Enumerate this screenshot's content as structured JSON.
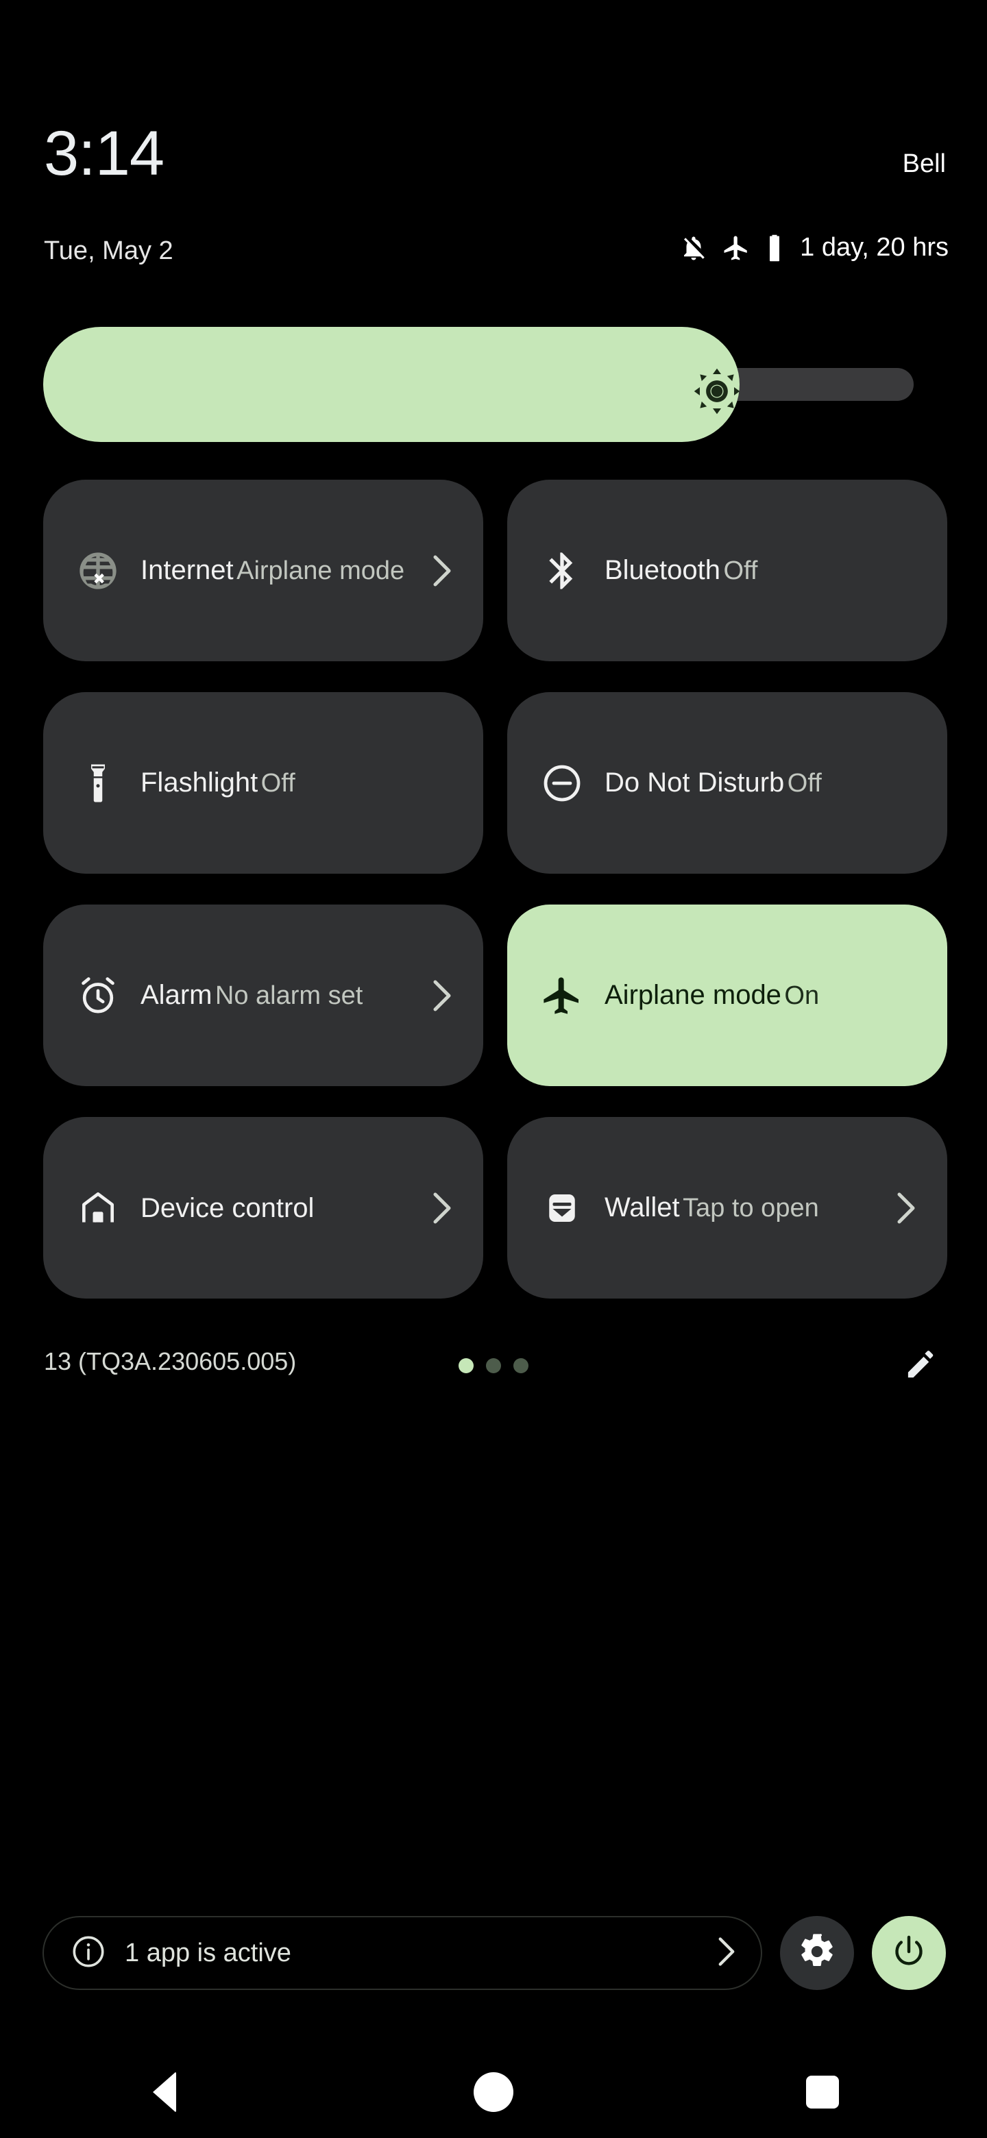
{
  "status": {
    "time": "3:14",
    "carrier": "Bell",
    "date": "Tue, May 2",
    "battery_estimate": "1 day, 20 hrs",
    "icons": [
      "notifications-off-icon",
      "airplane-icon",
      "battery-icon"
    ]
  },
  "brightness": {
    "label": "Brightness",
    "value_percent": 80,
    "icon": "brightness-icon"
  },
  "tiles": [
    {
      "id": "internet",
      "title": "Internet",
      "subtitle": "Airplane mode",
      "icon": "globe-off-icon",
      "active": false,
      "chevron": true
    },
    {
      "id": "bluetooth",
      "title": "Bluetooth",
      "subtitle": "Off",
      "icon": "bluetooth-icon",
      "active": false,
      "chevron": false
    },
    {
      "id": "flashlight",
      "title": "Flashlight",
      "subtitle": "Off",
      "icon": "flashlight-icon",
      "active": false,
      "chevron": false
    },
    {
      "id": "dnd",
      "title": "Do Not Disturb",
      "subtitle": "Off",
      "icon": "do-not-disturb-icon",
      "active": false,
      "chevron": false
    },
    {
      "id": "alarm",
      "title": "Alarm",
      "subtitle": "No alarm set",
      "icon": "alarm-clock-icon",
      "active": false,
      "chevron": true
    },
    {
      "id": "airplane-mode",
      "title": "Airplane mode",
      "subtitle": "On",
      "icon": "airplane-icon",
      "active": true,
      "chevron": false
    },
    {
      "id": "device-controls",
      "title": "Device control",
      "subtitle": "",
      "icon": "home-icon",
      "active": false,
      "chevron": true
    },
    {
      "id": "wallet",
      "title": "Wallet",
      "subtitle": "Tap to open",
      "icon": "wallet-icon",
      "active": false,
      "chevron": true
    }
  ],
  "qs_footer": {
    "build": "13 (TQ3A.230605.005)",
    "page_dots": {
      "count": 3,
      "active_index": 0
    },
    "edit_icon": "pencil-icon"
  },
  "bottom_bar": {
    "active_apps_text": "1 app is active",
    "info_icon": "info-icon",
    "chevron_icon": "chevron-right-icon",
    "settings_icon": "gear-icon",
    "power_icon": "power-icon"
  },
  "navbar": {
    "back": "back-button",
    "home": "home-button",
    "recents": "recents-button"
  },
  "colors": {
    "background": "#000000",
    "tile": "#303133",
    "accent": "#c6e7b8",
    "text_primary": "#f1f1f1",
    "text_secondary": "#c2c7c0",
    "dot_inactive": "#4d5c4b"
  }
}
